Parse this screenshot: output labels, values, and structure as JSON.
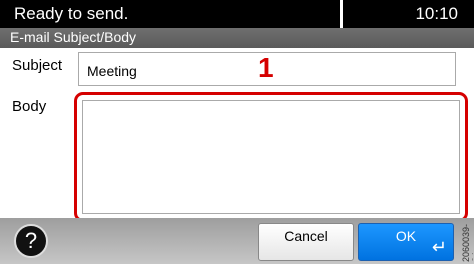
{
  "status": {
    "message": "Ready to send.",
    "time": "10:10"
  },
  "title": "E-mail Subject/Body",
  "subject": {
    "label": "Subject",
    "value": "Meeting"
  },
  "body": {
    "label": "Body",
    "value": ""
  },
  "callout": {
    "number": "1",
    "color": "#d50000"
  },
  "footer": {
    "help_icon": "?",
    "cancel_label": "Cancel",
    "ok_label": "OK",
    "ok_icon": "↵",
    "side_code": "2060039-24"
  },
  "colors": {
    "accent": "#0072e0",
    "highlight": "#d50000",
    "status_bar": "#000000",
    "title_bar": "#5a5a5a"
  }
}
